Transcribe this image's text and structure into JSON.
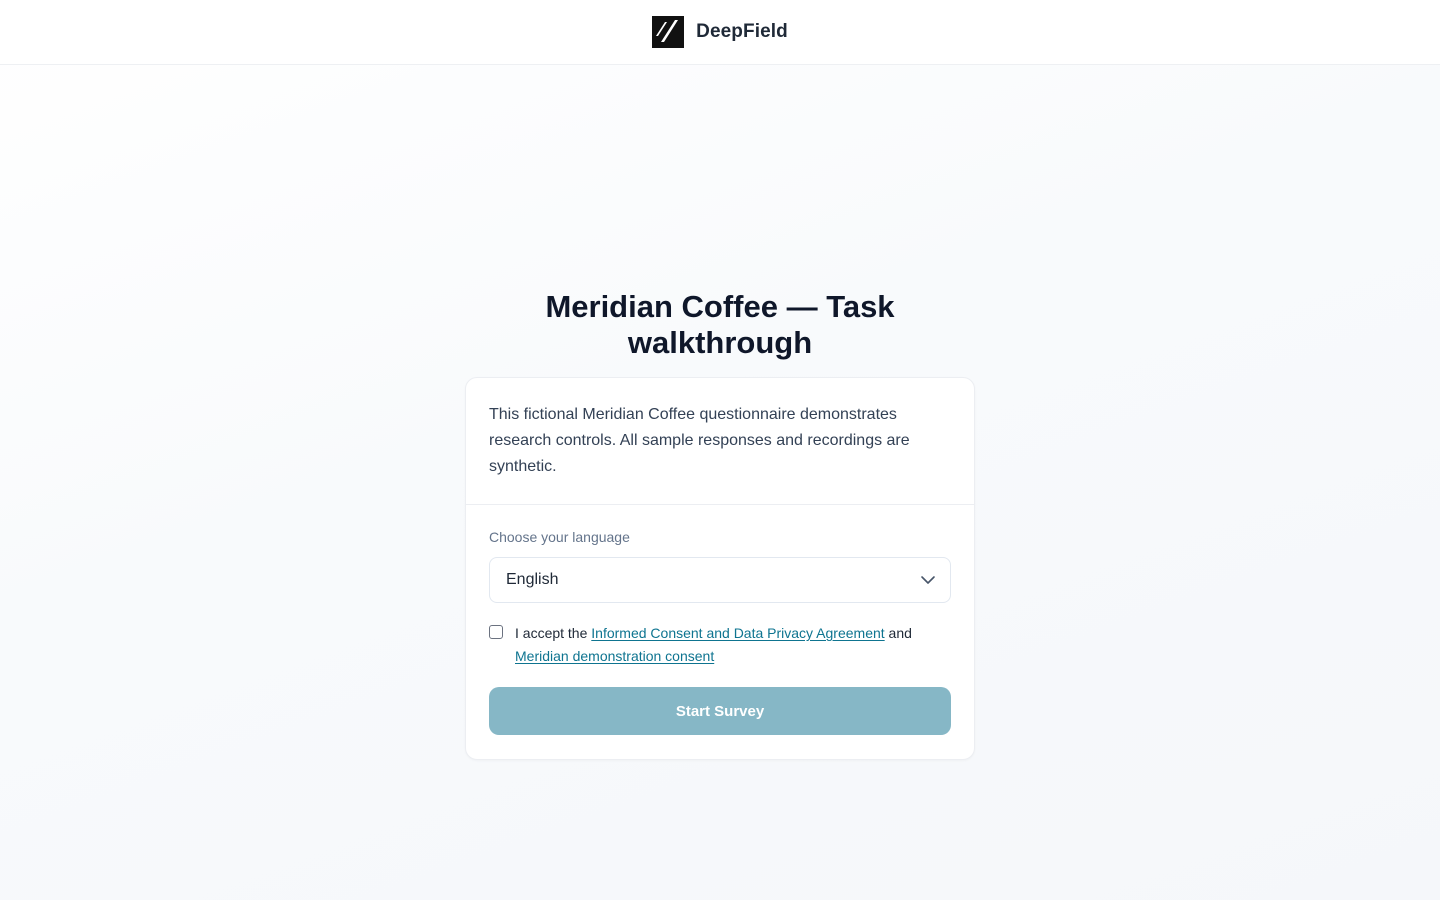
{
  "header": {
    "brand_name": "DeepField",
    "logo_icon": "deepfield-logo-icon"
  },
  "main": {
    "title": "Meridian Coffee — Task walkthrough",
    "intro": "This fictional Meridian Coffee questionnaire demonstrates research controls. All sample responses and recordings are synthetic.",
    "language": {
      "label": "Choose your language",
      "selected": "English"
    },
    "consent": {
      "checked": false,
      "prefix": "I accept the ",
      "link1": "Informed Consent and Data Privacy Agreement",
      "middle": " and ",
      "link2": "Meridian demonstration consent"
    },
    "start_button": {
      "label": "Start Survey",
      "enabled": false
    }
  },
  "colors": {
    "accent": "#0e7490",
    "button_disabled": "#86b7c6",
    "text_primary": "#0f172a",
    "text_muted": "#64748b"
  }
}
